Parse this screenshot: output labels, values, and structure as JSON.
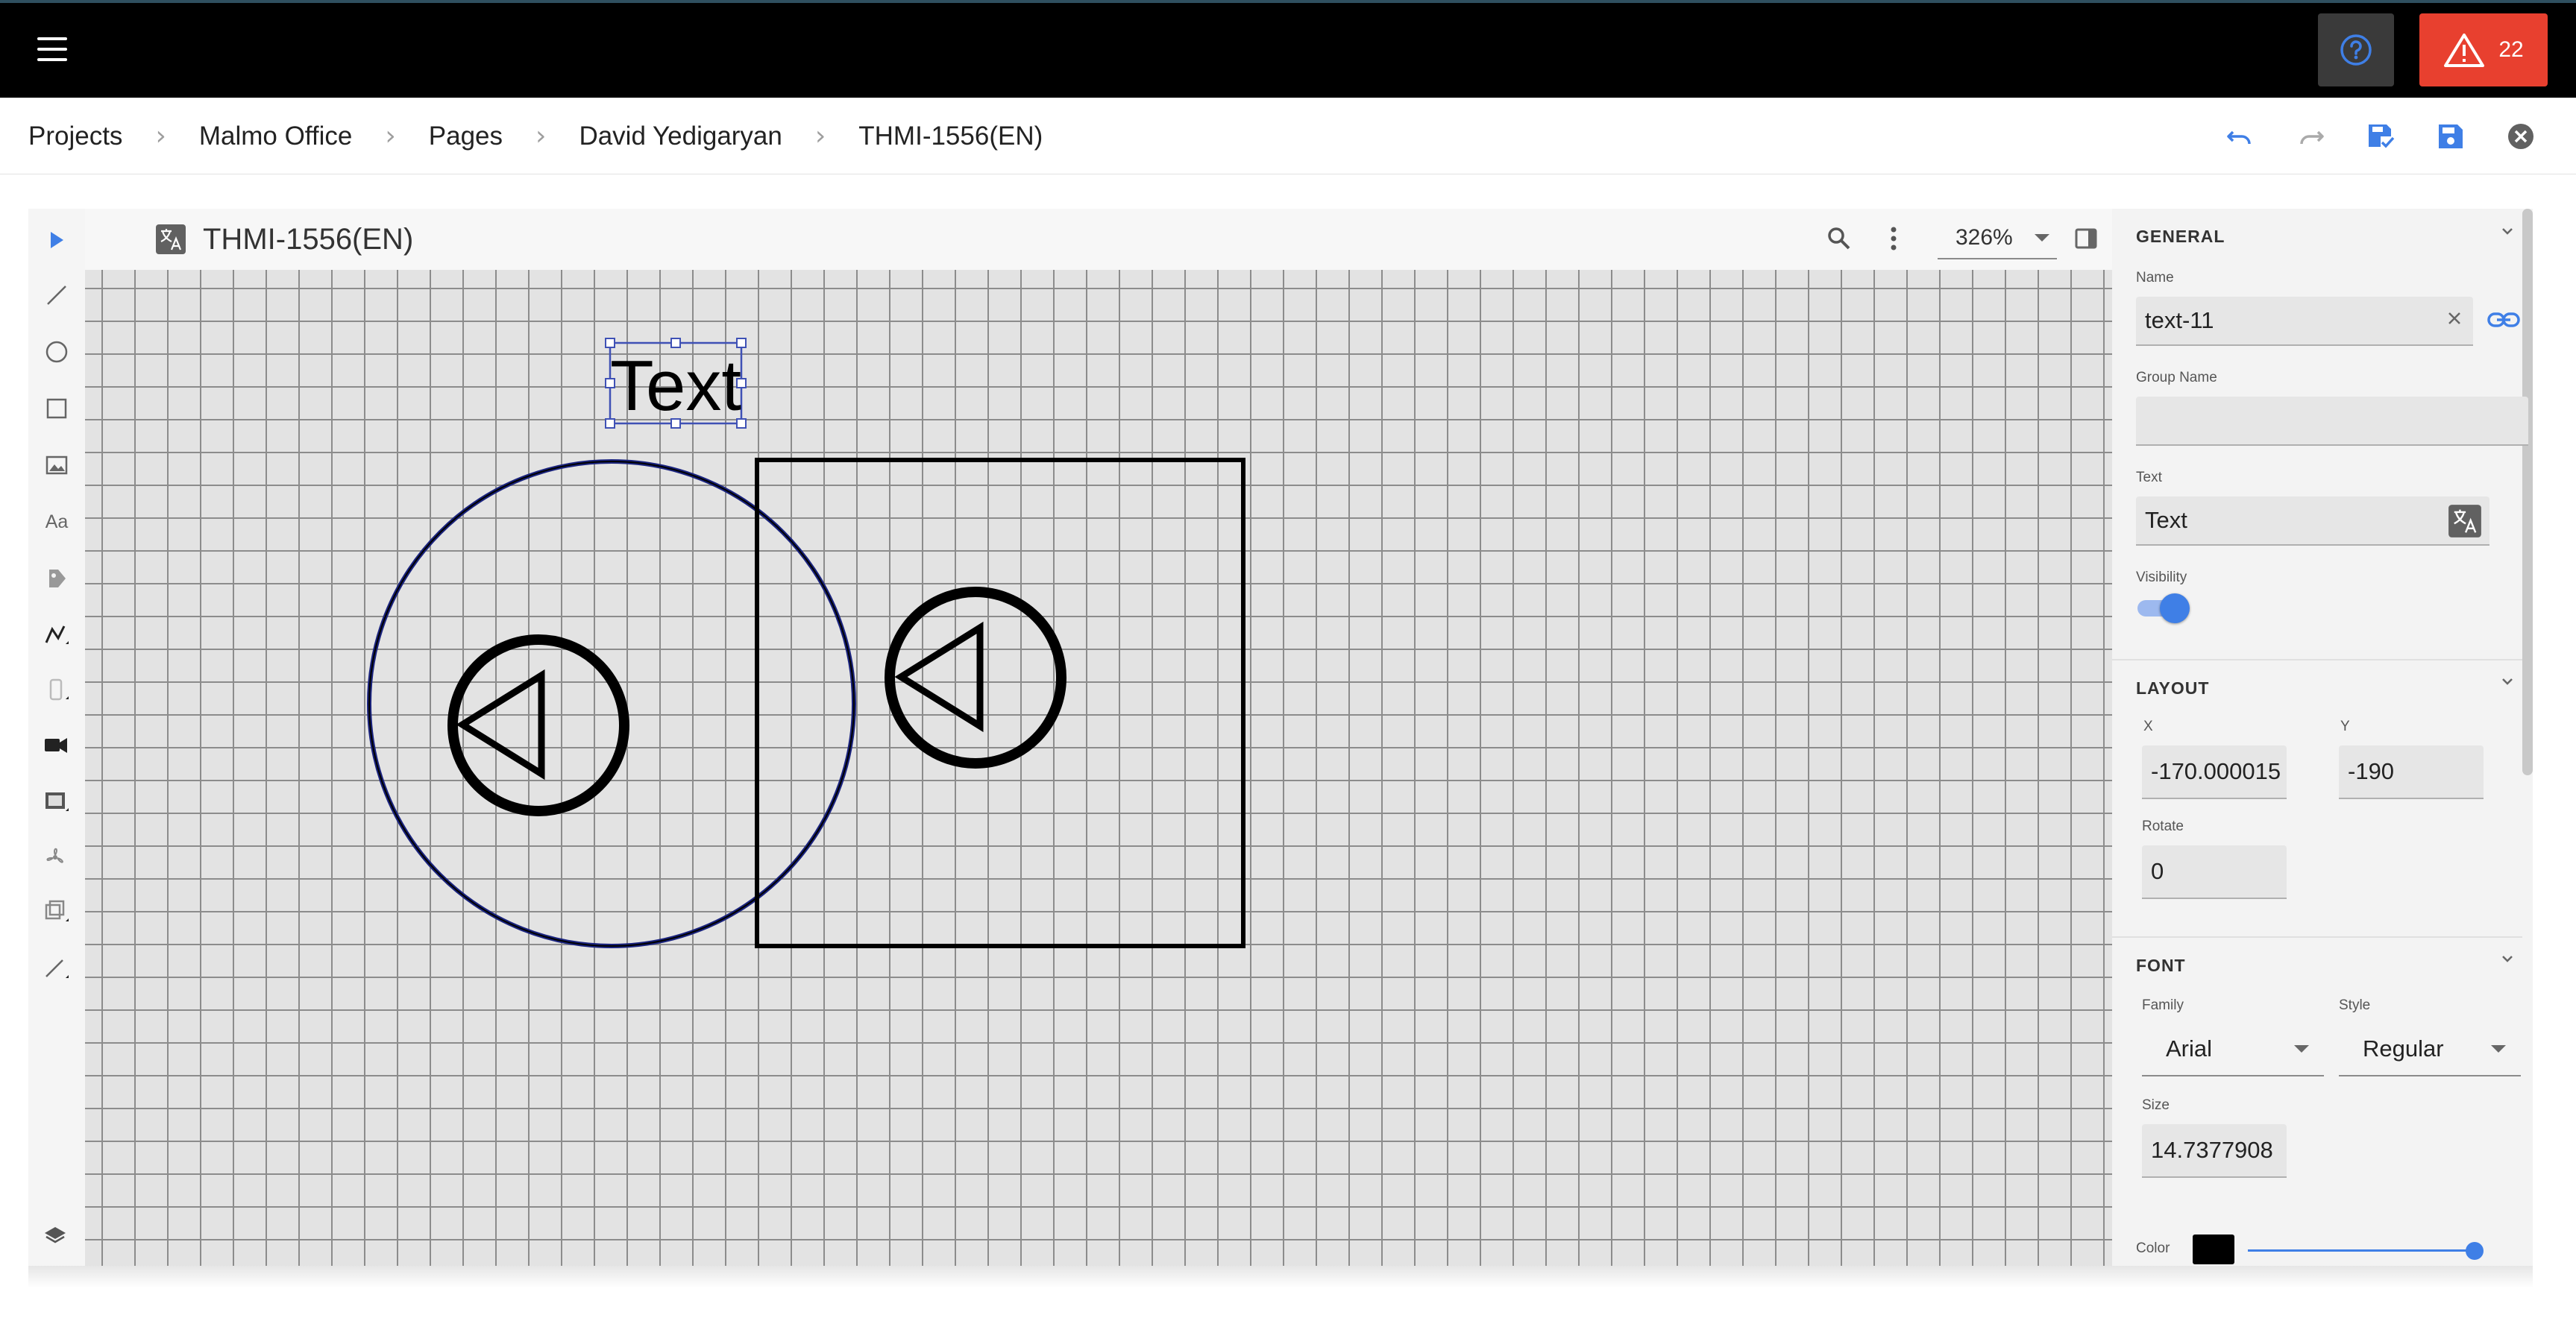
{
  "topbar": {
    "alert_count": "22",
    "colors": {
      "background": "#000000",
      "alert": "#e8402f",
      "help_bg": "#3a3a3a",
      "help_icon": "#3f7fe6"
    }
  },
  "breadcrumb": {
    "items": [
      "Projects",
      "Malmo Office",
      "Pages",
      "David Yedigaryan",
      "THMI-1556(EN)"
    ],
    "separator": "›",
    "actions": [
      "undo-icon",
      "redo-icon",
      "save-verify-icon",
      "save-icon",
      "close-circle-icon"
    ]
  },
  "toolbar": {
    "tools": [
      "pointer-icon",
      "line-icon",
      "circle-icon",
      "rectangle-icon",
      "image-icon",
      "text-tool-icon",
      "tag-icon",
      "polyline-icon",
      "device-icon",
      "camera-icon",
      "gauge-icon",
      "fan-icon",
      "copy-icon",
      "pen-icon",
      "layers-icon"
    ],
    "text_tool_label": "Aa"
  },
  "canvas": {
    "page_title": "THMI-1556(EN)",
    "zoom": "326%",
    "text_element": "Text"
  },
  "properties": {
    "general": {
      "header": "GENERAL",
      "name_label": "Name",
      "name_value": "text-11",
      "group_label": "Group Name",
      "group_value": "",
      "text_label": "Text",
      "text_value": "Text",
      "visibility_label": "Visibility",
      "visible": true
    },
    "layout": {
      "header": "LAYOUT",
      "x_label": "X",
      "x_value": "-170.000015",
      "y_label": "Y",
      "y_value": "-190",
      "rotate_label": "Rotate",
      "rotate_value": "0"
    },
    "font": {
      "header": "FONT",
      "family_label": "Family",
      "family_value": "Arial",
      "style_label": "Style",
      "style_value": "Regular",
      "size_label": "Size",
      "size_value": "14.7377908",
      "color_label": "Color",
      "color_value": "#000000",
      "opacity": 1.0
    }
  }
}
